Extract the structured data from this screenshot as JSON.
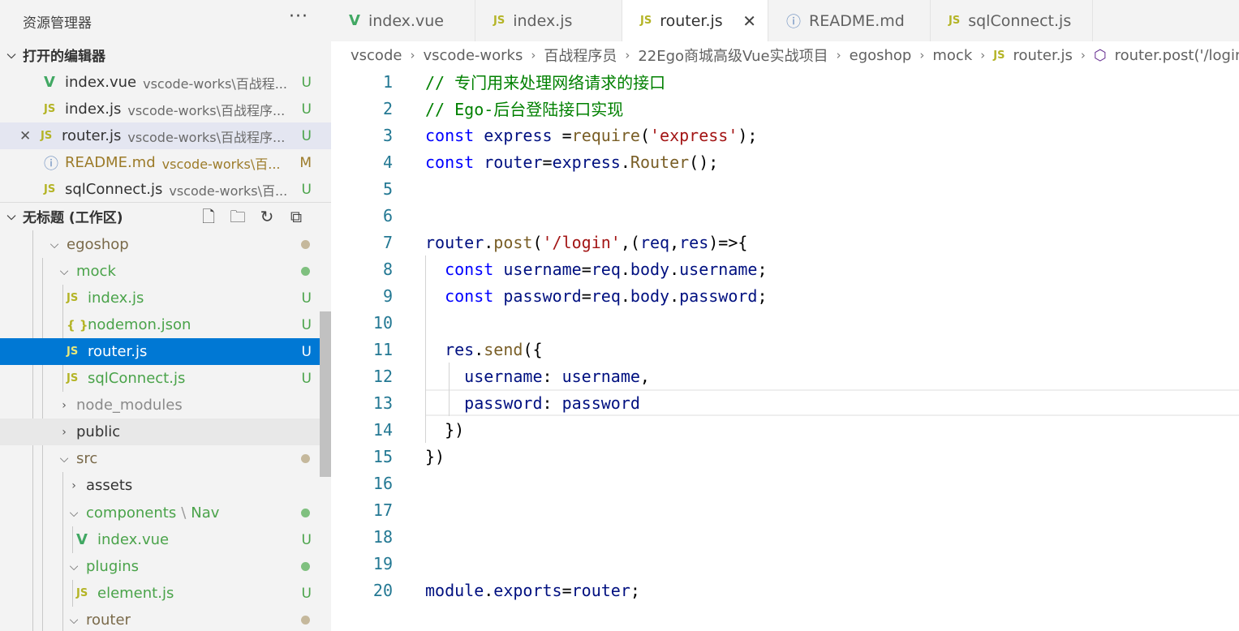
{
  "explorer": {
    "title": "资源管理器",
    "more_label": "···",
    "open_editors": {
      "label": "打开的编辑器",
      "items": [
        {
          "icon": "vue-icon",
          "name": "index.vue",
          "path": "vscode-works\\百战程...",
          "status": "U"
        },
        {
          "icon": "js-icon",
          "name": "index.js",
          "path": "vscode-works\\百战程序...",
          "status": "U"
        },
        {
          "icon": "js-icon",
          "name": "router.js",
          "path": "vscode-works\\百战程序...",
          "status": "U"
        },
        {
          "icon": "info-icon",
          "name": "README.md",
          "path": "vscode-works\\百...",
          "status": "M"
        },
        {
          "icon": "js-icon",
          "name": "sqlConnect.js",
          "path": "vscode-works\\百...",
          "status": "U"
        }
      ]
    },
    "workspace": {
      "label": "无标题 (工作区)",
      "tree": [
        {
          "name": "egoshop",
          "type": "folder-open"
        },
        {
          "name": "mock",
          "type": "folder-open"
        },
        {
          "name": "index.js",
          "type": "js",
          "status": "U"
        },
        {
          "name": "nodemon.json",
          "type": "json",
          "status": "U"
        },
        {
          "name": "router.js",
          "type": "js",
          "status": "U"
        },
        {
          "name": "sqlConnect.js",
          "type": "js",
          "status": "U"
        },
        {
          "name": "node_modules",
          "type": "folder"
        },
        {
          "name": "public",
          "type": "folder"
        },
        {
          "name": "src",
          "type": "folder-open"
        },
        {
          "name": "assets",
          "type": "folder"
        },
        {
          "name": "components",
          "sub": "Nav",
          "type": "folder-open"
        },
        {
          "name": "index.vue",
          "type": "vue",
          "status": "U"
        },
        {
          "name": "plugins",
          "type": "folder-open"
        },
        {
          "name": "element.js",
          "type": "js",
          "status": "U"
        },
        {
          "name": "router",
          "type": "folder-open"
        }
      ]
    }
  },
  "tabs": [
    {
      "icon": "vue-icon",
      "label": "index.vue"
    },
    {
      "icon": "js-icon",
      "label": "index.js"
    },
    {
      "icon": "js-icon",
      "label": "router.js",
      "active": true
    },
    {
      "icon": "info-icon",
      "label": "README.md"
    },
    {
      "icon": "js-icon",
      "label": "sqlConnect.js"
    }
  ],
  "breadcrumb": [
    "vscode",
    "vscode-works",
    "百战程序员",
    "22Ego商城高级Vue实战项目",
    "egoshop",
    "mock",
    "router.js",
    "router.post('/login"
  ],
  "icons": {
    "js": "JS",
    "json": "{ }",
    "vue": "V",
    "info": "ⓘ",
    "close": "✕"
  },
  "colors": {
    "selected": "#0078d4",
    "untracked": "#4aa34a",
    "modified": "#9c7b29",
    "dot_gray": "#c5b89c"
  },
  "editor": {
    "line_numbers": [
      "1",
      "2",
      "3",
      "4",
      "5",
      "6",
      "7",
      "8",
      "9",
      "10",
      "11",
      "12",
      "13",
      "14",
      "15",
      "16",
      "17",
      "18",
      "19",
      "20"
    ],
    "lines": [
      "// 专门用来处理网络请求的接口",
      "// Ego-后台登陆接口实现",
      "const express =require('express');",
      "const router=express.Router();",
      "",
      "",
      "router.post('/login',(req,res)=>{",
      "  const username=req.body.username;",
      "  const password=req.body.password;",
      "",
      "  res.send({",
      "    username: username,",
      "    password: password",
      "  })",
      "})",
      "",
      "",
      "",
      "",
      "module.exports=router;"
    ]
  }
}
